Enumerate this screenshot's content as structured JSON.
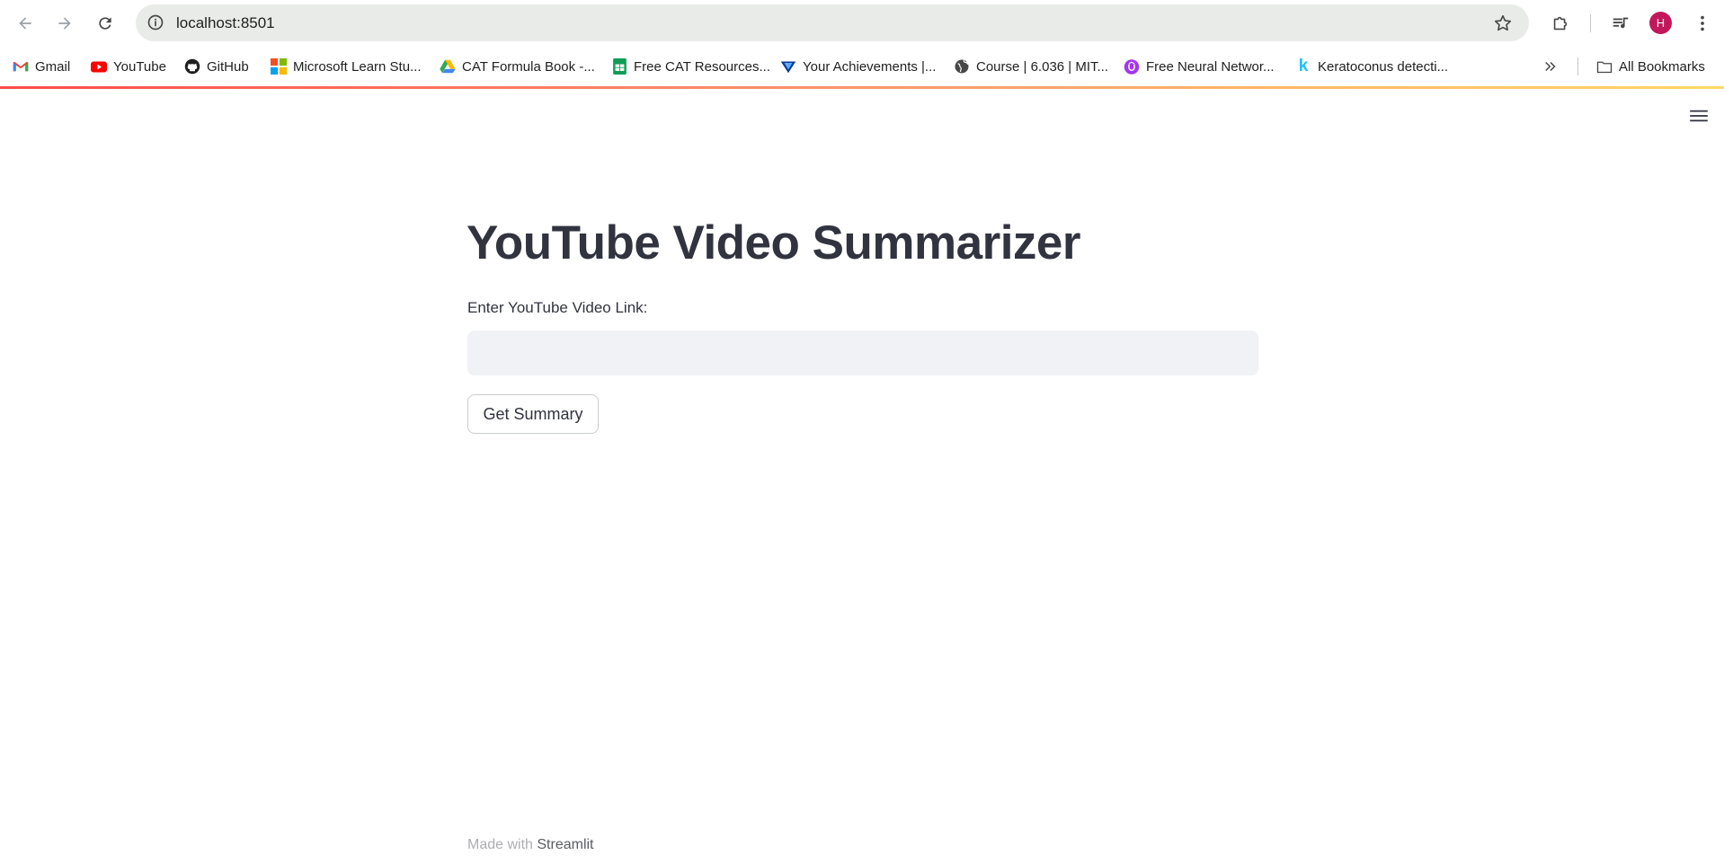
{
  "browser": {
    "url": "localhost:8501",
    "profile_initial": "H",
    "profile_color": "#c2185b",
    "icons": {
      "back": "arrow-left-icon",
      "forward": "arrow-right-icon",
      "reload": "reload-icon",
      "site_info": "info-icon",
      "bookmark_star": "star-icon",
      "extensions": "puzzle-icon",
      "media": "media-queue-icon",
      "menu": "kebab-menu-icon"
    }
  },
  "bookmarks": {
    "items": [
      {
        "label": "Gmail",
        "icon": "gmail-icon"
      },
      {
        "label": "YouTube",
        "icon": "youtube-icon"
      },
      {
        "label": "GitHub",
        "icon": "github-icon"
      },
      {
        "label": "Microsoft Learn Stu...",
        "icon": "microsoft-icon"
      },
      {
        "label": "CAT Formula Book -...",
        "icon": "google-drive-icon"
      },
      {
        "label": "Free CAT Resources...",
        "icon": "google-sheets-icon"
      },
      {
        "label": "Your Achievements |...",
        "icon": "badge-icon"
      },
      {
        "label": "Course | 6.036 | MIT...",
        "icon": "globe-icon"
      },
      {
        "label": "Free Neural Networ...",
        "icon": "udemy-icon"
      },
      {
        "label": "Keratoconus detecti...",
        "icon": "kaggle-icon"
      }
    ],
    "all_bookmarks_label": "All Bookmarks"
  },
  "app": {
    "title": "YouTube Video Summarizer",
    "input_label": "Enter YouTube Video Link:",
    "input_value": "",
    "button_label": "Get Summary",
    "footer_prefix": "Made with ",
    "footer_brand": "Streamlit",
    "accent_colors": [
      "#ff4b4b",
      "#ffd866"
    ]
  }
}
